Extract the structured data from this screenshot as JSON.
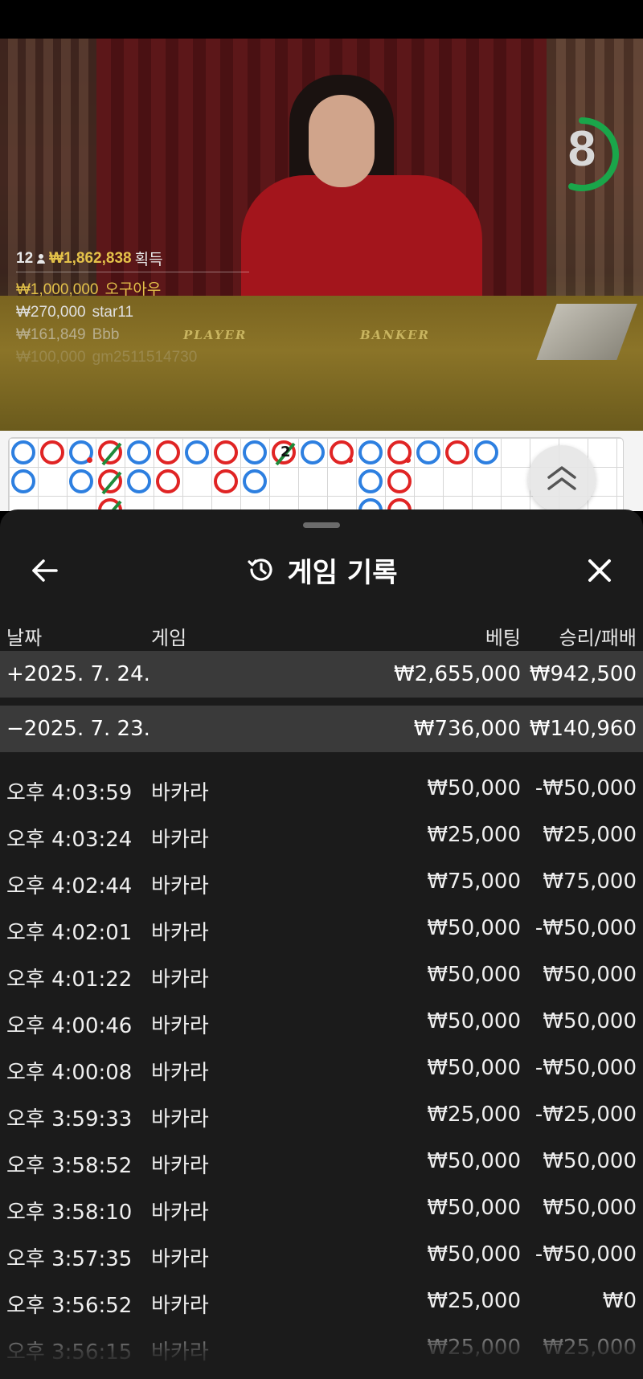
{
  "countdown": {
    "value": "8",
    "fraction": 0.55,
    "color": "#1aa64a"
  },
  "video": {
    "table_labels": [
      "PLAYER",
      "BANKER"
    ]
  },
  "winners": {
    "count": "12",
    "total": "₩1,862,838",
    "label": "획득",
    "rows": [
      {
        "amount": "₩1,000,000",
        "name": "오구아우"
      },
      {
        "amount": "₩270,000",
        "name": "star11"
      },
      {
        "amount": "₩161,849",
        "name": "Bbb"
      },
      {
        "amount": "₩100,000",
        "name": "gm2511514730"
      }
    ]
  },
  "roadmap": {
    "columns": [
      [
        "P",
        "P"
      ],
      [
        "B"
      ],
      [
        "P*",
        "P"
      ],
      [
        "B/",
        "B/",
        "B/"
      ],
      [
        "P",
        "P"
      ],
      [
        "B",
        "B"
      ],
      [
        "P"
      ],
      [
        "B",
        "B"
      ],
      [
        "P",
        "P"
      ],
      [
        "B2"
      ],
      [
        "P"
      ],
      [
        "B*"
      ],
      [
        "P",
        "P",
        "P"
      ],
      [
        "B*",
        "B",
        "B"
      ],
      [
        "P"
      ],
      [
        "B"
      ],
      [
        "P"
      ]
    ]
  },
  "sheet": {
    "title": "게임 기록",
    "columns": {
      "date": "날짜",
      "game": "게임",
      "bet": "베팅",
      "win": "승리/패배"
    },
    "days": [
      {
        "date": "+2025. 7. 24.",
        "bet": "₩2,655,000",
        "win": "₩942,500"
      },
      {
        "date": "−2025. 7. 23.",
        "bet": "₩736,000",
        "win": "₩140,960"
      }
    ],
    "rows": [
      {
        "time": "오후 4:03:59",
        "game": "바카라",
        "bet": "₩50,000",
        "win": "-₩50,000"
      },
      {
        "time": "오후 4:03:24",
        "game": "바카라",
        "bet": "₩25,000",
        "win": "₩25,000"
      },
      {
        "time": "오후 4:02:44",
        "game": "바카라",
        "bet": "₩75,000",
        "win": "₩75,000"
      },
      {
        "time": "오후 4:02:01",
        "game": "바카라",
        "bet": "₩50,000",
        "win": "-₩50,000"
      },
      {
        "time": "오후 4:01:22",
        "game": "바카라",
        "bet": "₩50,000",
        "win": "₩50,000"
      },
      {
        "time": "오후 4:00:46",
        "game": "바카라",
        "bet": "₩50,000",
        "win": "₩50,000"
      },
      {
        "time": "오후 4:00:08",
        "game": "바카라",
        "bet": "₩50,000",
        "win": "-₩50,000"
      },
      {
        "time": "오후 3:59:33",
        "game": "바카라",
        "bet": "₩25,000",
        "win": "-₩25,000"
      },
      {
        "time": "오후 3:58:52",
        "game": "바카라",
        "bet": "₩50,000",
        "win": "₩50,000"
      },
      {
        "time": "오후 3:58:10",
        "game": "바카라",
        "bet": "₩50,000",
        "win": "₩50,000"
      },
      {
        "time": "오후 3:57:35",
        "game": "바카라",
        "bet": "₩50,000",
        "win": "-₩50,000"
      },
      {
        "time": "오후 3:56:52",
        "game": "바카라",
        "bet": "₩25,000",
        "win": "₩0"
      },
      {
        "time": "오후 3:56:15",
        "game": "바카라",
        "bet": "₩25,000",
        "win": "₩25,000"
      }
    ]
  },
  "icons": {
    "back": "arrow-left-icon",
    "history": "history-icon",
    "close": "close-icon",
    "expand": "chevron-up-double-icon"
  }
}
